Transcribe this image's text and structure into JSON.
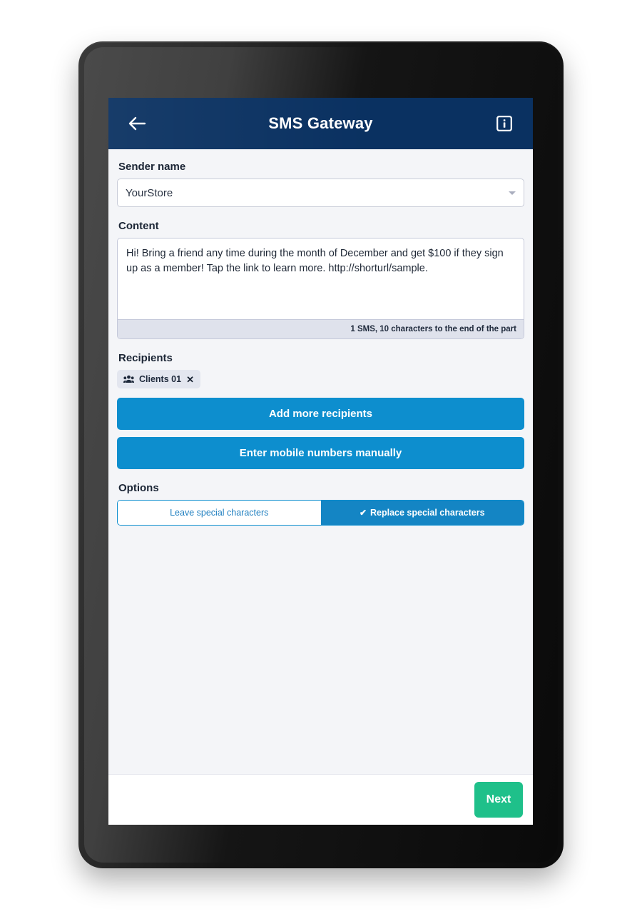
{
  "device": {
    "camera_icon": "camera-dot",
    "speaker_icon": "speaker-grille"
  },
  "app_bar": {
    "back_icon": "arrow-left-icon",
    "title": "SMS Gateway",
    "info_icon": "info-square-icon",
    "background_color": "#0a3161"
  },
  "sender": {
    "label": "Sender name",
    "value": "YourStore",
    "caret_icon": "chevron-down-icon"
  },
  "content": {
    "label": "Content",
    "value": "Hi! Bring a friend any time during the month of December and get $100 if they sign up as a member! Tap the link to learn more. http://shorturl/sample.",
    "placeholder": "",
    "counter": "1 SMS, 10 characters to the end of the part"
  },
  "recipients": {
    "label": "Recipients",
    "chips": [
      {
        "icon": "users-group-icon",
        "label": "Clients 01",
        "remove_icon": "close-icon"
      }
    ],
    "add_more_label": "Add more recipients",
    "manual_entry_label": "Enter mobile numbers manually"
  },
  "options": {
    "label": "Options",
    "segments": [
      {
        "label": "Leave special characters",
        "active": false,
        "check_icon": ""
      },
      {
        "label": "Replace special characters",
        "active": true,
        "check_icon": "✔"
      }
    ]
  },
  "footer": {
    "next_label": "Next"
  },
  "colors": {
    "header_navy": "#0a3161",
    "primary_blue": "#0d8ece",
    "segment_blue": "#1485c4",
    "next_green": "#1fc08a",
    "page_bg": "#f4f5f8",
    "counter_bg": "#dfe2ec",
    "chip_bg": "#e3e6ef"
  }
}
